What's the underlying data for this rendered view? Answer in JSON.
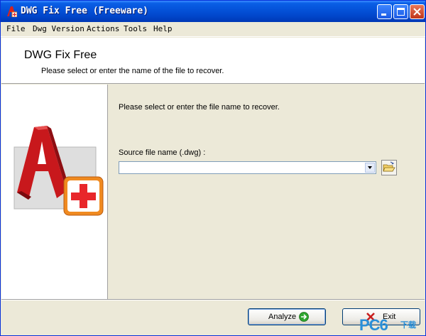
{
  "window": {
    "title": "DWG Fix Free (Freeware)"
  },
  "menu": [
    {
      "key": "file",
      "label": "File"
    },
    {
      "key": "dwg-version",
      "label": "Dwg Version"
    },
    {
      "key": "actions",
      "label": "Actions"
    },
    {
      "key": "tools",
      "label": "Tools"
    },
    {
      "key": "help",
      "label": "Help"
    }
  ],
  "header": {
    "title": "DWG Fix Free",
    "subtitle": "Please select or enter the name of the file to recover."
  },
  "content": {
    "instruction": "Please select or enter the file name to recover.",
    "source_label": "Source file name (.dwg) :",
    "source_value": ""
  },
  "buttons": {
    "analyze": "Analyze",
    "exit": "Exit"
  },
  "watermark": {
    "brand": "PC6",
    "sub": "下载"
  },
  "icons": {
    "app": "autocad-a-icon",
    "browse": "open-folder-icon",
    "analyze": "green-arrow-icon",
    "exit": "red-x-icon",
    "side": "autocad-repair-logo"
  },
  "colors": {
    "title_bar": "#0553DA",
    "accent_red": "#D8231E",
    "medical_red": "#E8262A"
  }
}
